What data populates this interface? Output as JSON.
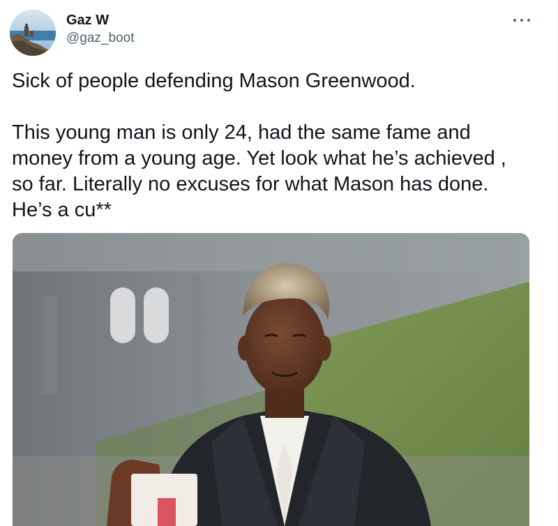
{
  "tweet": {
    "author": {
      "display_name": "Gaz W",
      "handle": "@gaz_boot",
      "avatar_icon": "avatar-coastal-photo"
    },
    "more_icon": "more-horizontal-icon",
    "text": {
      "line1": "Sick of people defending Mason Greenwood.",
      "line2": "This young man is only 24, had the same fame and",
      "line3": "money from a young age. Yet look what he’s achieved ,",
      "line4": "so far. Literally no excuses for what Mason has done.",
      "line5": "He’s a cu**"
    },
    "media": {
      "type": "photo",
      "icon": "photo-young-man-suit"
    }
  },
  "colors": {
    "text": "#0f1419",
    "secondary": "#536471",
    "background": "#ffffff"
  }
}
